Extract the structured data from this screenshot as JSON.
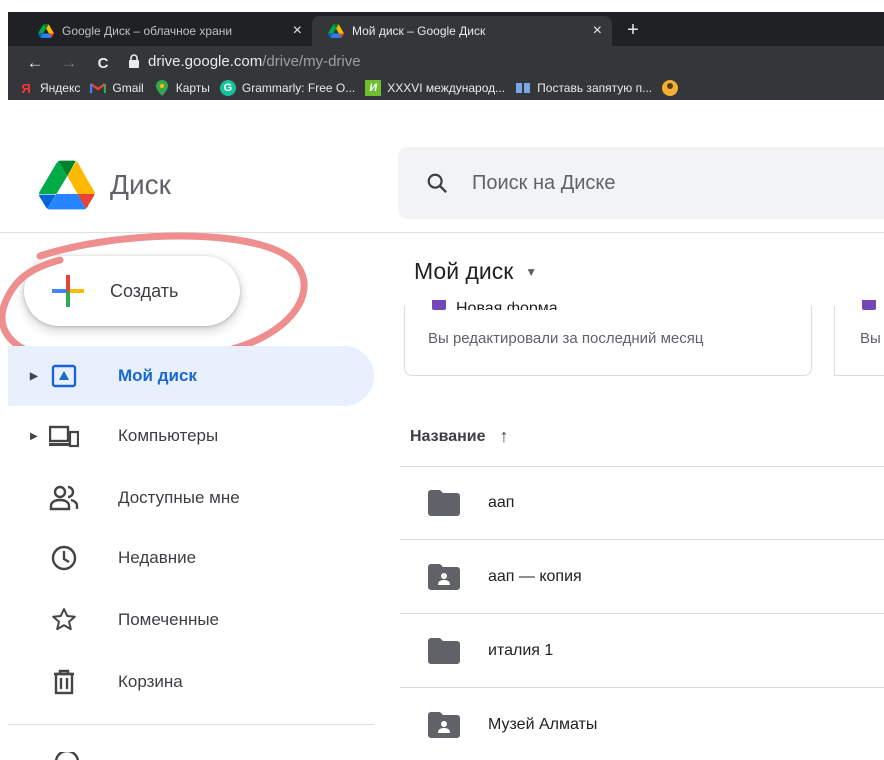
{
  "browser": {
    "tabs": [
      {
        "title": "Google Диск – облачное храни",
        "close": "×",
        "active": false
      },
      {
        "title": "Мой диск – Google Диск",
        "close": "×",
        "active": true
      }
    ],
    "new_tab": "+",
    "nav": {
      "back": "←",
      "forward": "→",
      "reload": "C"
    },
    "url": {
      "host": "drive.google.com",
      "path": "/drive/my-drive"
    },
    "bookmarks": [
      {
        "label": "Яндекс",
        "icon": "yandex-icon"
      },
      {
        "label": "Gmail",
        "icon": "gmail-icon"
      },
      {
        "label": "Карты",
        "icon": "maps-icon"
      },
      {
        "label": "Grammarly: Free O...",
        "icon": "grammarly-icon"
      },
      {
        "label": "XXXVI международ...",
        "icon": "letter-i-icon"
      },
      {
        "label": "Поставь запятую п...",
        "icon": "book-icon"
      }
    ]
  },
  "drive": {
    "brand": "Диск",
    "search": {
      "placeholder": "Поиск на Диске"
    },
    "create_label": "Создать",
    "sidebar": [
      {
        "label": "Мой диск",
        "icon": "my-drive-icon",
        "active": true,
        "caret": true
      },
      {
        "label": "Компьютеры",
        "icon": "computers-icon",
        "active": false,
        "caret": true
      },
      {
        "label": "Доступные мне",
        "icon": "shared-icon",
        "active": false,
        "caret": false
      },
      {
        "label": "Недавние",
        "icon": "clock-icon",
        "active": false,
        "caret": false
      },
      {
        "label": "Помеченные",
        "icon": "star-icon",
        "active": false,
        "caret": false
      },
      {
        "label": "Корзина",
        "icon": "trash-icon",
        "active": false,
        "caret": false
      }
    ],
    "main_title": "Мой диск",
    "suggested": {
      "card_name": "Новая форма",
      "card1_sub": "Вы редактировали за последний месяц",
      "card2_sub": "Вы"
    },
    "column_header": "Название",
    "sort_arrow": "↑",
    "files": [
      {
        "name": "аап",
        "type": "folder"
      },
      {
        "name": "аап — копия",
        "type": "shared-folder"
      },
      {
        "name": "италия 1",
        "type": "folder"
      },
      {
        "name": "Музей Алматы",
        "type": "shared-folder"
      }
    ]
  },
  "colors": {
    "accent": "#1967d2",
    "annotation": "#e88a8a",
    "active_bg": "#e8f0fe"
  }
}
